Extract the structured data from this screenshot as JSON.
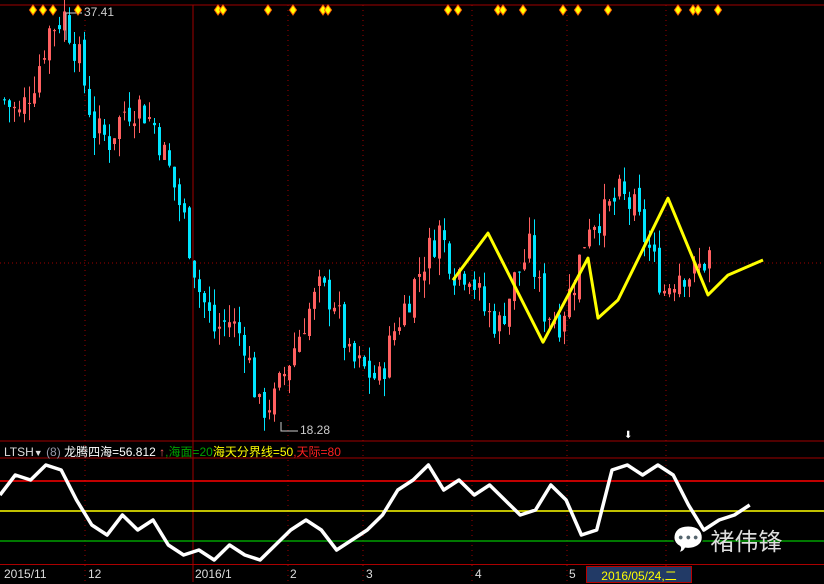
{
  "chart_data": {
    "type": "candlestick",
    "title": "",
    "high_label": "37.41",
    "low_label": "18.28",
    "price_range": [
      18.28,
      37.41
    ],
    "close_keypoints": [
      33.38,
      32.7,
      34.3,
      36.59,
      37.27,
      35.21,
      32.01,
      31.55,
      32.92,
      33.15,
      32.24,
      30.18,
      27.89,
      24.69,
      22.86,
      23.31,
      22.4,
      19.19,
      19.65,
      21.48,
      23.31,
      24.69,
      24.23,
      21.48,
      21.02,
      20.57,
      22.86,
      24.46,
      26.06,
      27.43,
      25.6,
      25.6,
      23.77,
      23.08,
      25.14,
      26.52,
      23.77,
      23.31,
      25.14,
      27.89,
      28.12,
      29.03,
      28.35,
      26.52,
      24.69,
      25.6,
      25.37,
      26.29
    ],
    "candles_per_keypoint": 3,
    "trend_line": [
      [
        90,
        25.14
      ],
      [
        97,
        27.29
      ],
      [
        108,
        22.3
      ],
      [
        117,
        26.15
      ],
      [
        119,
        23.4
      ],
      [
        123,
        24.23
      ],
      [
        133,
        28.89
      ],
      [
        141,
        24.46
      ],
      [
        145,
        25.37
      ],
      [
        152,
        26.06
      ]
    ],
    "signal_marker_candles": [
      6,
      8,
      10,
      15,
      43,
      44,
      53,
      58,
      64,
      65,
      89,
      91,
      99,
      100,
      104,
      112,
      115,
      121,
      135,
      138,
      139,
      143
    ],
    "x_ticks": [
      "2015/11",
      "12",
      "2016/1",
      "2",
      "3",
      "4",
      "5"
    ],
    "indicator": {
      "name": "LTSH",
      "param": "(8)",
      "label": "龙腾四海=56.812",
      "arrow": "↑",
      "lines": [
        {
          "label": ",海面=20",
          "value": 20,
          "color": "#00a000"
        },
        {
          "label": "海天分界线=50",
          "value": 50,
          "color": "#ffff00"
        },
        {
          "label": ",天际=80",
          "value": 80,
          "color": "#ff0000"
        }
      ],
      "range": [
        -4,
        100
      ],
      "values": [
        66,
        86,
        81,
        96,
        91,
        61,
        36,
        26,
        46,
        31,
        41,
        16,
        6,
        11,
        1,
        16,
        6,
        1,
        16,
        31,
        41,
        31,
        11,
        21,
        31,
        46,
        71,
        81,
        96,
        71,
        81,
        66,
        76,
        61,
        46,
        51,
        76,
        61,
        26,
        31,
        91,
        96,
        86,
        96,
        86,
        56,
        31,
        41,
        46,
        56
      ]
    },
    "cursor_date": "2016/05/24,二"
  },
  "watermark": "褚伟锋",
  "colors": {
    "up": "#ff6060",
    "down": "#00e5ff",
    "trend": "#ffff00",
    "grid": "#a00000"
  }
}
